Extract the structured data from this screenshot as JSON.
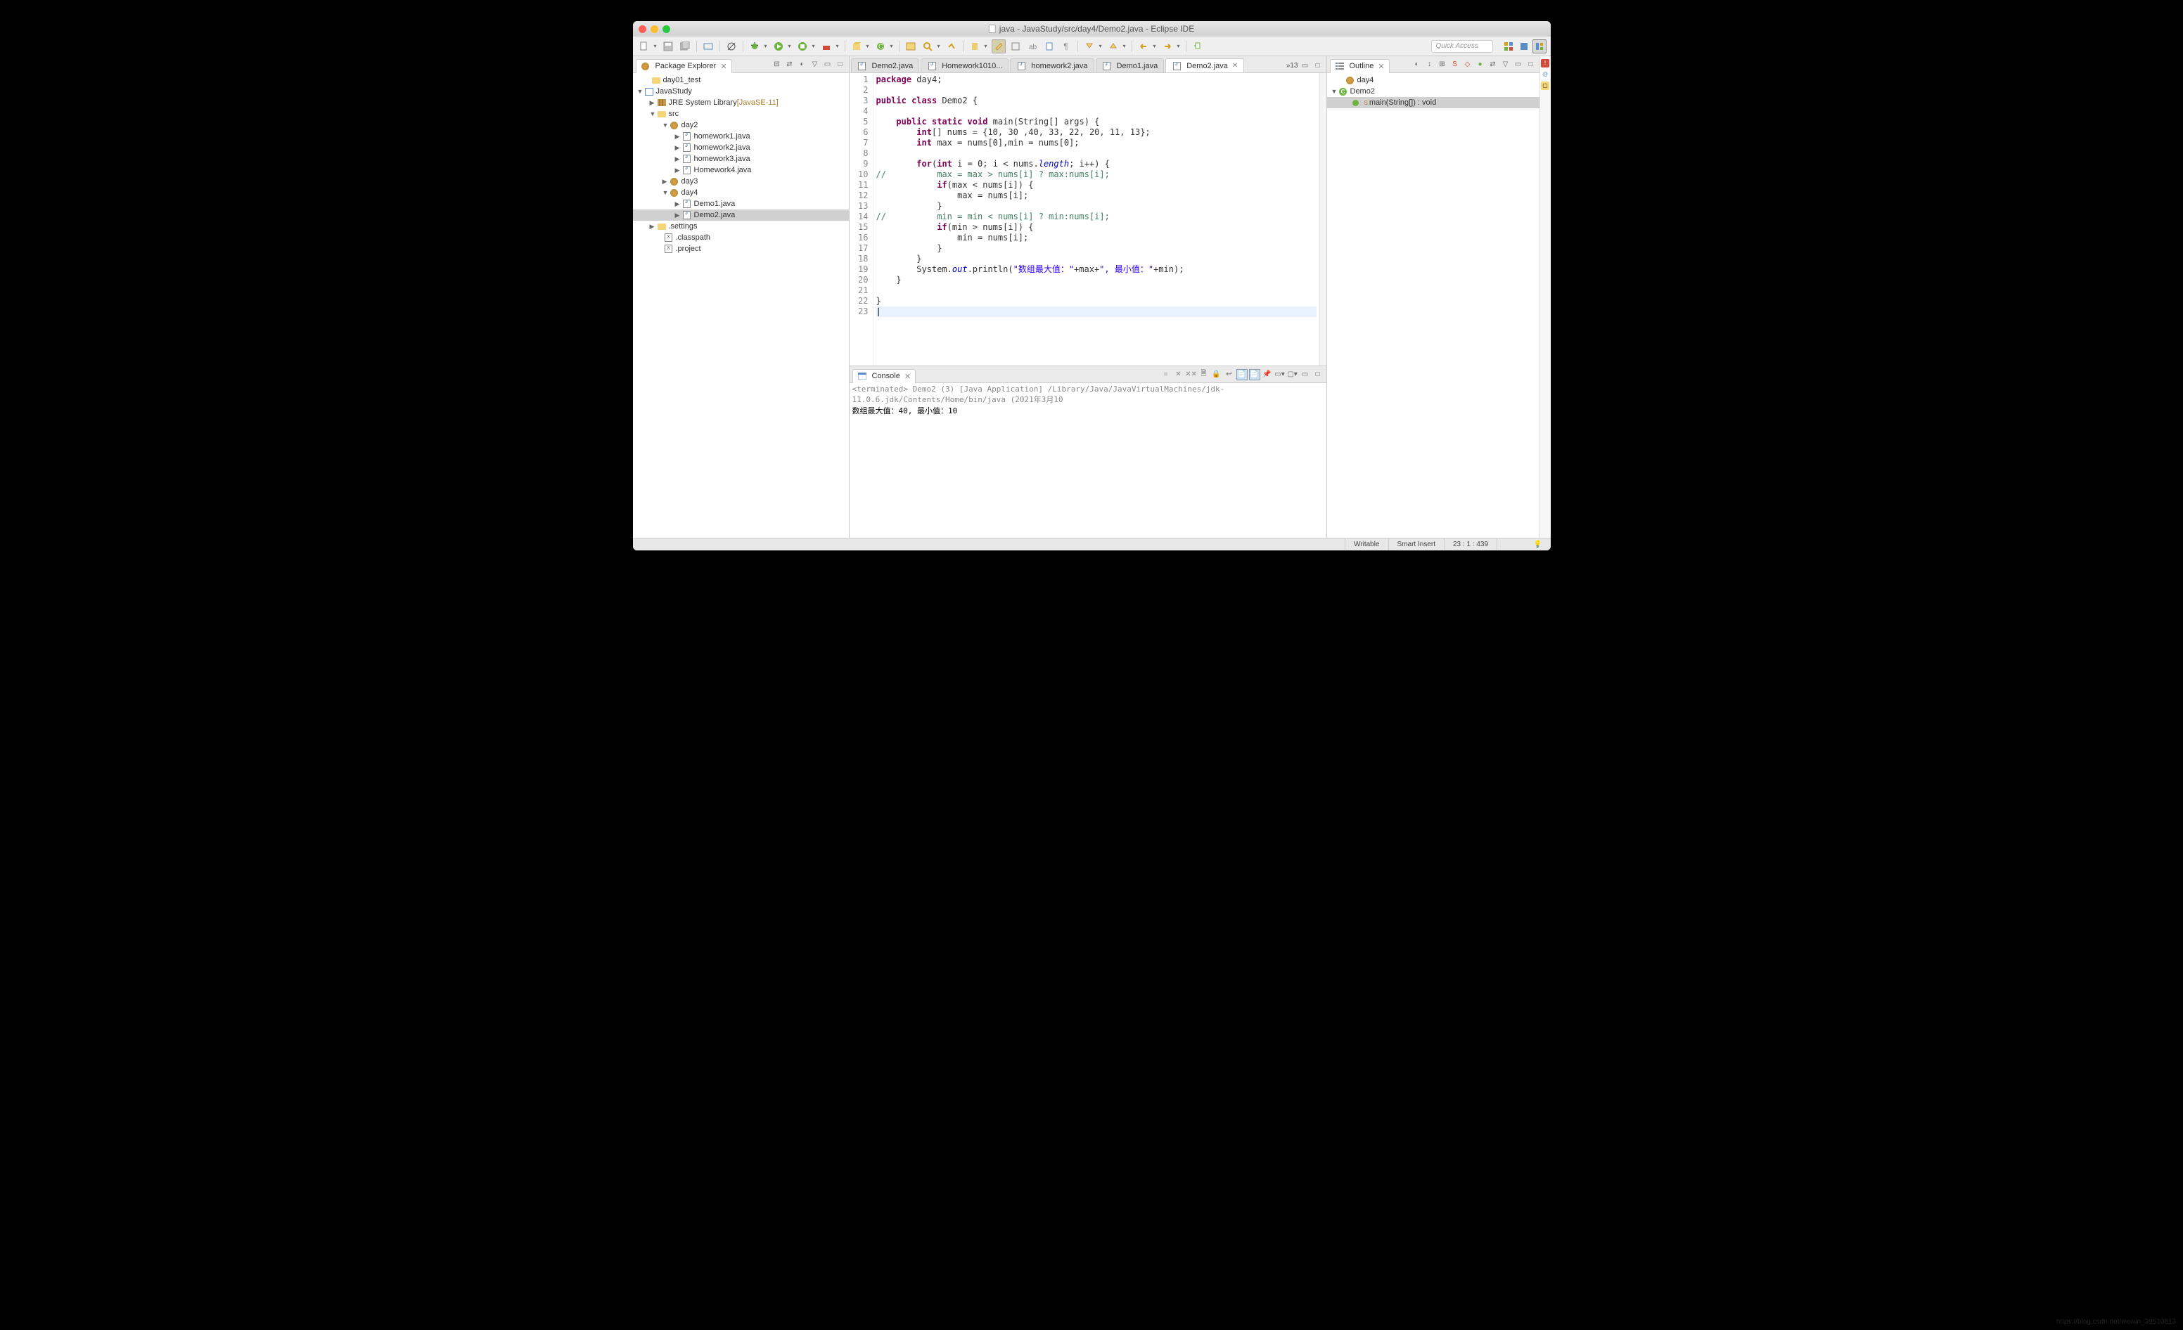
{
  "window": {
    "title": "java - JavaStudy/src/day4/Demo2.java - Eclipse IDE"
  },
  "quick_access": {
    "placeholder": "Quick Access"
  },
  "package_explorer": {
    "title": "Package Explorer",
    "items": [
      {
        "label": "day01_test",
        "indent": 12,
        "icon": "folder-p",
        "arrow": "none"
      },
      {
        "label": "JavaStudy",
        "indent": 2,
        "icon": "proj",
        "arrow": "open"
      },
      {
        "label": "JRE System Library",
        "suffix": " [JavaSE-11]",
        "indent": 20,
        "icon": "lib",
        "arrow": "closed"
      },
      {
        "label": "src",
        "indent": 20,
        "icon": "folder",
        "arrow": "open"
      },
      {
        "label": "day2",
        "indent": 38,
        "icon": "pkg",
        "arrow": "open"
      },
      {
        "label": "homework1.java",
        "indent": 56,
        "icon": "jfile",
        "arrow": "closed"
      },
      {
        "label": "homework2.java",
        "indent": 56,
        "icon": "jfile",
        "arrow": "closed"
      },
      {
        "label": "homework3.java",
        "indent": 56,
        "icon": "jfile",
        "arrow": "closed"
      },
      {
        "label": "Homework4.java",
        "indent": 56,
        "icon": "jfile",
        "arrow": "closed"
      },
      {
        "label": "day3",
        "indent": 38,
        "icon": "pkg",
        "arrow": "closed"
      },
      {
        "label": "day4",
        "indent": 38,
        "icon": "pkg",
        "arrow": "open"
      },
      {
        "label": "Demo1.java",
        "indent": 56,
        "icon": "jfile",
        "arrow": "closed"
      },
      {
        "label": "Demo2.java",
        "indent": 56,
        "icon": "jfile",
        "arrow": "closed",
        "sel": true
      },
      {
        "label": ".settings",
        "indent": 20,
        "icon": "folder",
        "arrow": "closed"
      },
      {
        "label": ".classpath",
        "indent": 30,
        "icon": "xfile",
        "arrow": "none"
      },
      {
        "label": ".project",
        "indent": 30,
        "icon": "xfile",
        "arrow": "none"
      }
    ]
  },
  "editor_tabs": [
    {
      "label": "Demo2.java",
      "active": false
    },
    {
      "label": "Homework1010...",
      "active": false
    },
    {
      "label": "homework2.java",
      "active": false
    },
    {
      "label": "Demo1.java",
      "active": false
    },
    {
      "label": "Demo2.java",
      "active": true
    }
  ],
  "editor_overflow": "»13",
  "code": {
    "lines": 23,
    "raw": [
      {
        "t": [
          [
            "kw",
            "package"
          ],
          [
            "pl",
            " day4;"
          ]
        ]
      },
      {
        "t": []
      },
      {
        "t": [
          [
            "kw",
            "public class"
          ],
          [
            "pl",
            " Demo2 {"
          ]
        ]
      },
      {
        "t": []
      },
      {
        "t": [
          [
            "pl",
            "    "
          ],
          [
            "kw",
            "public static void"
          ],
          [
            "pl",
            " main(String[] args) {"
          ]
        ]
      },
      {
        "t": [
          [
            "pl",
            "        "
          ],
          [
            "kw",
            "int"
          ],
          [
            "pl",
            "[] nums = {10, 30 ,40, 33, 22, 20, 11, 13};"
          ]
        ]
      },
      {
        "t": [
          [
            "pl",
            "        "
          ],
          [
            "kw",
            "int"
          ],
          [
            "pl",
            " max = nums[0],min = nums[0];"
          ]
        ]
      },
      {
        "t": []
      },
      {
        "t": [
          [
            "pl",
            "        "
          ],
          [
            "kw",
            "for"
          ],
          [
            "pl",
            "("
          ],
          [
            "kw",
            "int"
          ],
          [
            "pl",
            " i = 0; i < nums."
          ],
          [
            "field",
            "length"
          ],
          [
            "pl",
            "; i++) {"
          ]
        ]
      },
      {
        "t": [
          [
            "comm",
            "//          max = max > nums[i] ? max:nums[i];"
          ]
        ]
      },
      {
        "t": [
          [
            "pl",
            "            "
          ],
          [
            "kw",
            "if"
          ],
          [
            "pl",
            "(max < nums[i]) {"
          ]
        ]
      },
      {
        "t": [
          [
            "pl",
            "                max = nums[i];"
          ]
        ]
      },
      {
        "t": [
          [
            "pl",
            "            }"
          ]
        ]
      },
      {
        "t": [
          [
            "comm",
            "//          min = min < nums[i] ? min:nums[i];"
          ]
        ]
      },
      {
        "t": [
          [
            "pl",
            "            "
          ],
          [
            "kw",
            "if"
          ],
          [
            "pl",
            "(min > nums[i]) {"
          ]
        ]
      },
      {
        "t": [
          [
            "pl",
            "                min = nums[i];"
          ]
        ]
      },
      {
        "t": [
          [
            "pl",
            "            }"
          ]
        ]
      },
      {
        "t": [
          [
            "pl",
            "        }"
          ]
        ]
      },
      {
        "t": [
          [
            "pl",
            "        System."
          ],
          [
            "field",
            "out"
          ],
          [
            "pl",
            ".println("
          ],
          [
            "str",
            "\"数组最大值：\""
          ],
          [
            "pl",
            "+max+"
          ],
          [
            "str",
            "\", 最小值：\""
          ],
          [
            "pl",
            "+min);"
          ]
        ]
      },
      {
        "t": [
          [
            "pl",
            "    }"
          ]
        ]
      },
      {
        "t": []
      },
      {
        "t": [
          [
            "pl",
            "}"
          ]
        ]
      },
      {
        "t": [],
        "cur": true
      }
    ]
  },
  "outline": {
    "title": "Outline",
    "items": [
      {
        "label": "day4",
        "indent": 12,
        "icon": "pkg",
        "arrow": "none"
      },
      {
        "label": "Demo2",
        "indent": 2,
        "icon": "class",
        "arrow": "open"
      },
      {
        "label": "main(String[]) : void",
        "indent": 22,
        "icon": "method",
        "arrow": "none",
        "sup": "S",
        "sel": true
      }
    ]
  },
  "console": {
    "title": "Console",
    "launch": "<terminated> Demo2 (3) [Java Application] /Library/Java/JavaVirtualMachines/jdk-11.0.6.jdk/Contents/Home/bin/java (2021年3月10",
    "output": "数组最大值：40, 最小值：10"
  },
  "statusbar": {
    "mode": "Writable",
    "insert": "Smart Insert",
    "pos": "23 : 1 : 439"
  },
  "watermark": "https://blog.csdn.net/weixin_39510813"
}
